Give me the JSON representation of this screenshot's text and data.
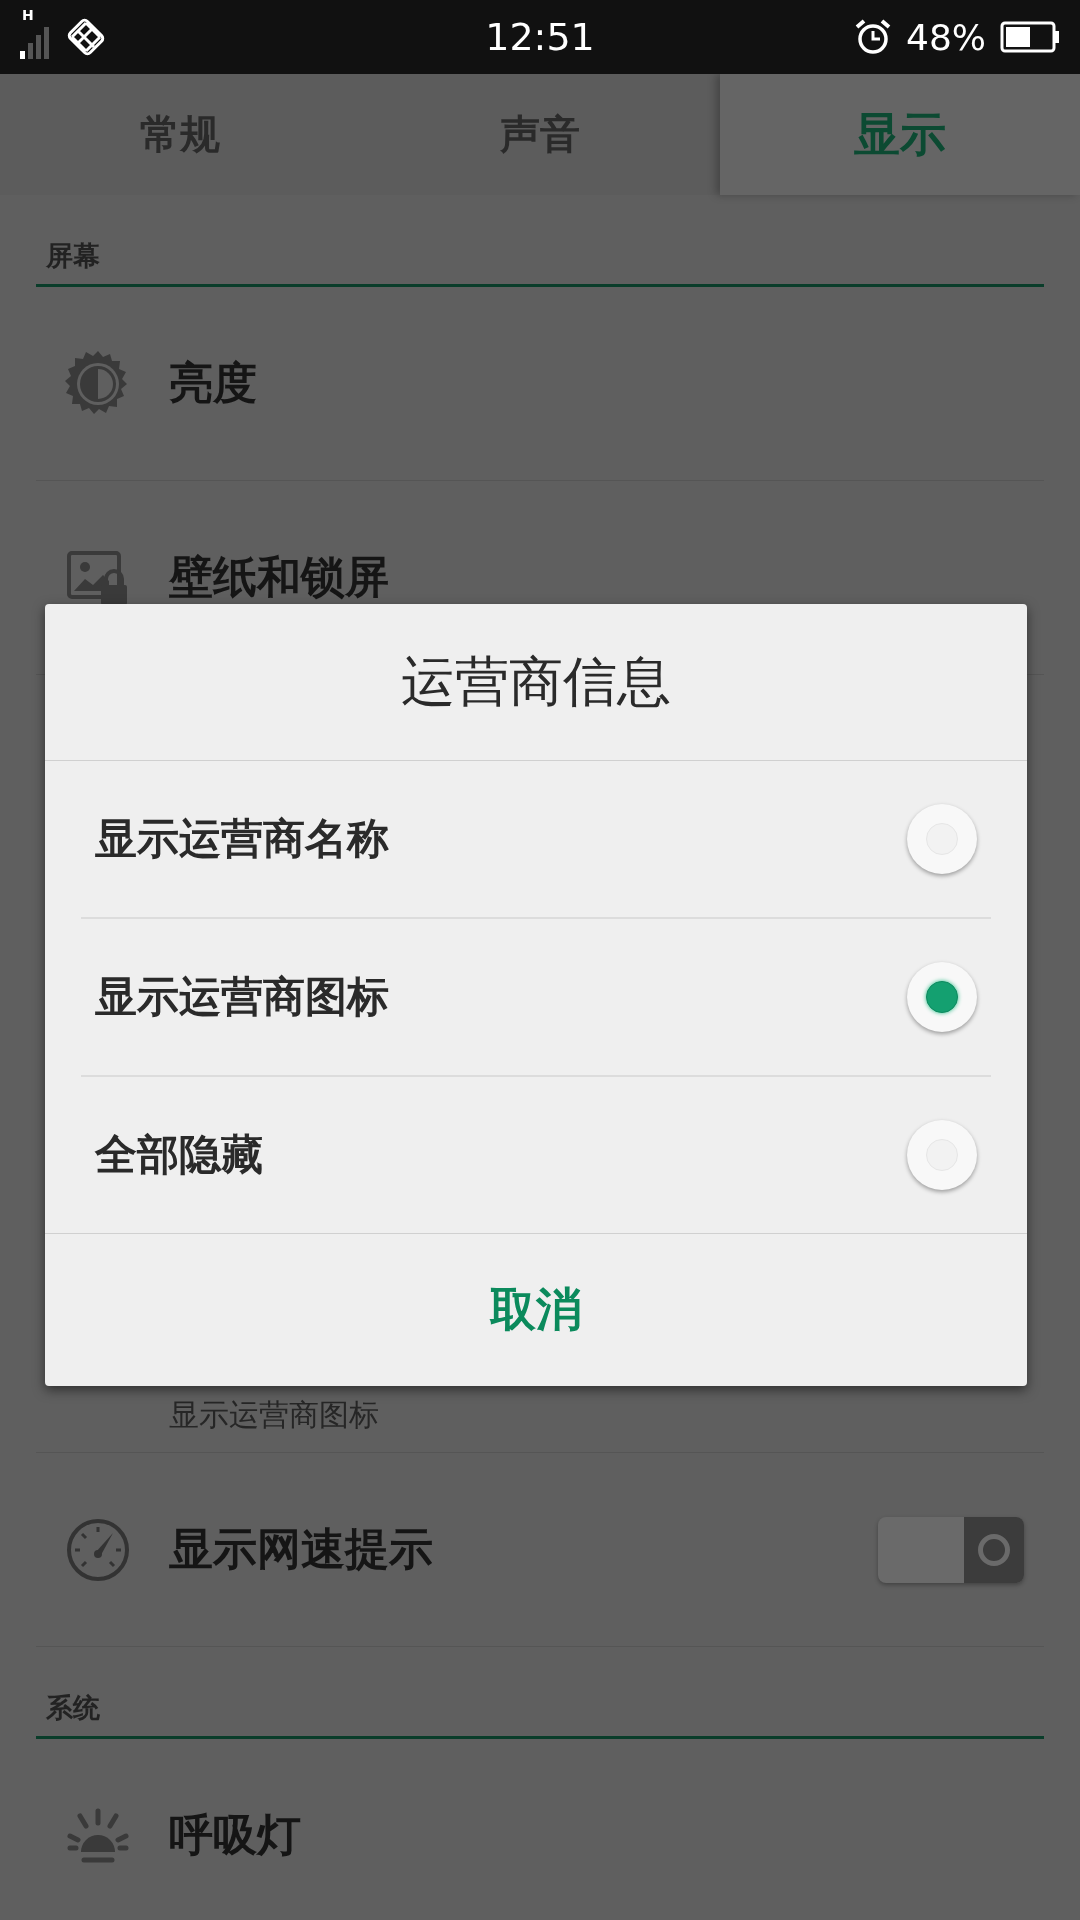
{
  "status_bar": {
    "time": "12:51",
    "battery": "48%",
    "network_type": "H"
  },
  "tabs": [
    {
      "label": "常规",
      "selected": false
    },
    {
      "label": "声音",
      "selected": false
    },
    {
      "label": "显示",
      "selected": true
    }
  ],
  "sections": [
    {
      "title": "屏幕",
      "rows": [
        {
          "kind": "plain",
          "title": "亮度"
        },
        {
          "kind": "plain",
          "title": "壁纸和锁屏"
        },
        {
          "kind": "covered",
          "subtitle": "显示运营商图标"
        },
        {
          "kind": "toggle",
          "title": "显示网速提示",
          "on": false
        }
      ]
    },
    {
      "title": "系统",
      "rows": [
        {
          "kind": "plain",
          "title": "呼吸灯"
        }
      ]
    }
  ],
  "dialog": {
    "title": "运营商信息",
    "options": [
      {
        "label": "显示运营商名称",
        "selected": false
      },
      {
        "label": "显示运营商图标",
        "selected": true
      },
      {
        "label": "全部隐藏",
        "selected": false
      }
    ],
    "cancel": "取消"
  }
}
